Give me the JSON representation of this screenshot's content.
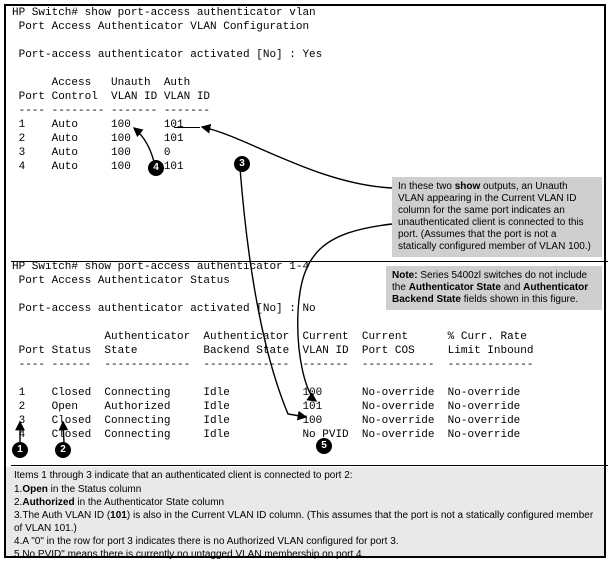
{
  "cli1": {
    "prompt": "HP Switch# ",
    "cmd": "show port-access authenticator vlan",
    "title": " Port Access Authenticator VLAN Configuration",
    "activated_label_prefix": " Port-access authenticator activated [No] : ",
    "activated_value": "Yes",
    "hdr1": "      Access   Unauth  Auth",
    "hdr2": " Port Control  VLAN ID VLAN ID",
    "sep": " ---- -------- ------- -------",
    "rows": [
      " 1    Auto     100     101",
      " 2    Auto     100     101",
      " 3    Auto     100     0",
      " 4    Auto     100     101"
    ]
  },
  "cli2": {
    "prompt": "HP Switch# ",
    "cmd": "show port-access authenticator 1-4",
    "title": " Port Access Authenticator Status",
    "activated_label_prefix": " Port-access authenticator activated [No] : ",
    "activated_value": "No",
    "hdr1": "              Authenticator  Authenticator  Current  Current      % Curr. Rate",
    "hdr2": " Port Status  State          Backend State  VLAN ID  Port COS     Limit Inbound",
    "sep": " ---- ------  -------------  -------------  -------  -----------  -------------",
    "rows": [
      " 1    Closed  Connecting     Idle           100      No-override  No-override",
      " 2    Open    Authorized     Idle           101      No-override  No-override",
      " 3    Closed  Connecting     Idle           100      No-override  No-override",
      " 4    Closed  Connecting     Idle           No PVID  No-override  No-override"
    ]
  },
  "notes": {
    "a": {
      "lead": "In these two ",
      "bold1": "show",
      "rest": " outputs, an Unauth VLAN appearing in the Current VLAN ID column for the same port indicates an unauthenticated client is connected to this port. (Assumes that the port is not a statically configured member of VLAN 100.)"
    },
    "b": {
      "lead": "Note: ",
      "rest1": "Series 5400zl switches do not include the ",
      "bold1": "Authenticator State",
      "mid": " and ",
      "bold2": "Authenticator Backend State",
      "rest2": " fields shown in this figure."
    }
  },
  "footer": {
    "lead": "Items 1 through 3 indicate that an authenticated client is connected to port 2:",
    "i1a": "1.",
    "i1b": "Open",
    "i1c": " in the Status column",
    "i2a": "2.",
    "i2b": "Authorized",
    "i2c": " in the Authenticator State column",
    "i3a": "3.The Auth VLAN ID (",
    "i3b": "101",
    "i3c": ") is also in the Current VLAN ID column. (This assumes that the port is not a statically configured member of VLAN 101.)",
    "i4": "4.A \"0\" in the row for port 3 indicates there is no Authorized VLAN configured for port 3.",
    "i5": "5.No PVID\" means there is currently no untagged VLAN membership on port 4."
  },
  "badges": {
    "n1": "1",
    "n2": "2",
    "n3": "3",
    "n4": "4",
    "n5": "5"
  }
}
